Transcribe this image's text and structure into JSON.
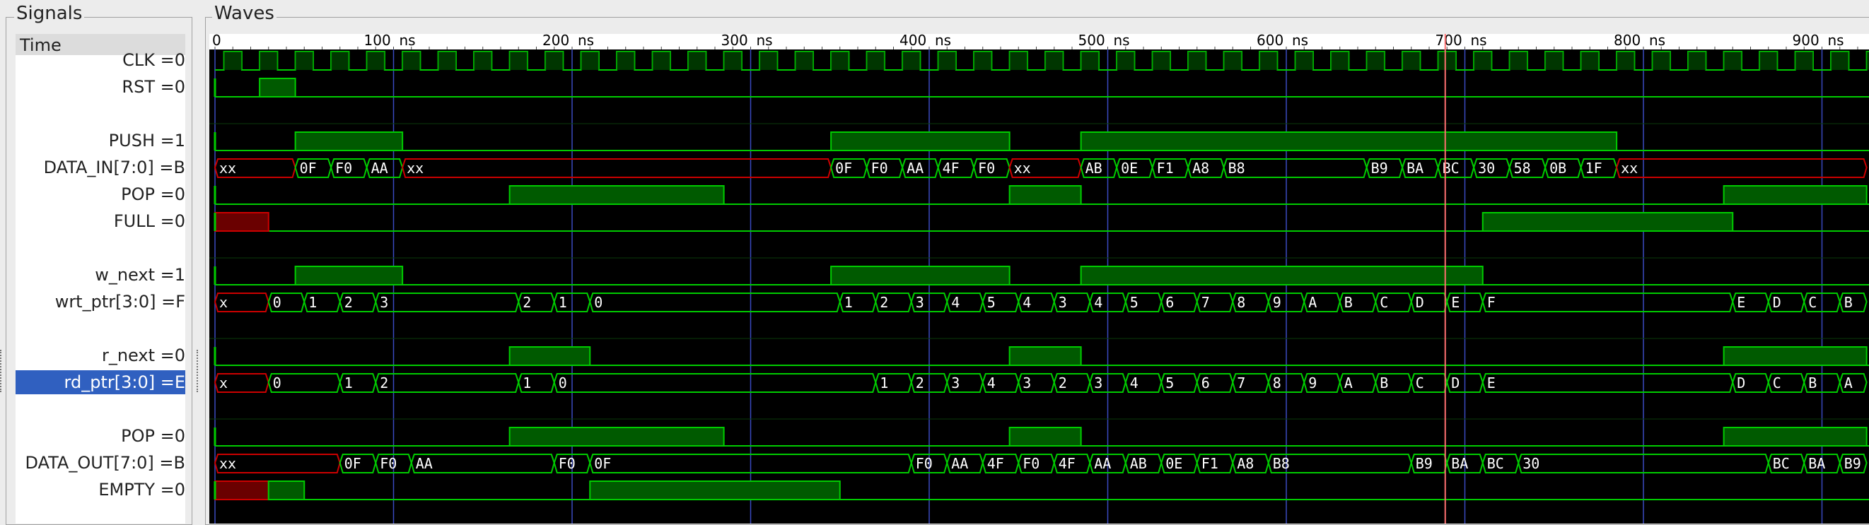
{
  "panels": {
    "signals_title": "Signals",
    "waves_title": "Waves"
  },
  "time_header": "Time",
  "time_axis": {
    "units": "ns",
    "labels": [
      "0",
      "100",
      "200",
      "300",
      "400",
      "500",
      "600",
      "700",
      "800",
      "900"
    ],
    "cursor_ns": 689
  },
  "colors": {
    "wave_bg": "#000000",
    "wave_green": "#00cc00",
    "wave_red": "#cc0000",
    "grid": "#3a4ac0",
    "cursor": "#ff7070",
    "selected": "#3060c0"
  },
  "signals": [
    {
      "label": "CLK =0",
      "kind": "clock"
    },
    {
      "label": "RST =0",
      "kind": "bit",
      "highs": [
        [
          25,
          45
        ]
      ]
    },
    {
      "label": "",
      "kind": "blank"
    },
    {
      "label": "PUSH =1",
      "kind": "bit",
      "highs": [
        [
          45,
          105
        ],
        [
          345,
          445
        ],
        [
          485,
          785
        ]
      ]
    },
    {
      "label": "DATA_IN[7:0] =B",
      "kind": "bus",
      "segments": [
        {
          "s": 0,
          "e": 45,
          "v": "xx",
          "red": true
        },
        {
          "s": 45,
          "e": 65,
          "v": "0F"
        },
        {
          "s": 65,
          "e": 85,
          "v": "F0"
        },
        {
          "s": 85,
          "e": 105,
          "v": "AA"
        },
        {
          "s": 105,
          "e": 345,
          "v": "xx",
          "red": true
        },
        {
          "s": 345,
          "e": 365,
          "v": "0F"
        },
        {
          "s": 365,
          "e": 385,
          "v": "F0"
        },
        {
          "s": 385,
          "e": 405,
          "v": "AA"
        },
        {
          "s": 405,
          "e": 425,
          "v": "4F"
        },
        {
          "s": 425,
          "e": 445,
          "v": "F0"
        },
        {
          "s": 445,
          "e": 485,
          "v": "xx",
          "red": true
        },
        {
          "s": 485,
          "e": 505,
          "v": "AB"
        },
        {
          "s": 505,
          "e": 525,
          "v": "0E"
        },
        {
          "s": 525,
          "e": 545,
          "v": "F1"
        },
        {
          "s": 545,
          "e": 565,
          "v": "A8"
        },
        {
          "s": 565,
          "e": 645,
          "v": "B8"
        },
        {
          "s": 645,
          "e": 665,
          "v": "B9"
        },
        {
          "s": 665,
          "e": 685,
          "v": "BA"
        },
        {
          "s": 685,
          "e": 705,
          "v": "BC"
        },
        {
          "s": 705,
          "e": 725,
          "v": "30"
        },
        {
          "s": 725,
          "e": 745,
          "v": "58"
        },
        {
          "s": 745,
          "e": 765,
          "v": "0B"
        },
        {
          "s": 765,
          "e": 785,
          "v": "1F"
        },
        {
          "s": 785,
          "e": 925,
          "v": "xx",
          "red": true
        }
      ]
    },
    {
      "label": "POP =0",
      "kind": "bit",
      "highs": [
        [
          165,
          285
        ],
        [
          445,
          485
        ],
        [
          845,
          925
        ]
      ]
    },
    {
      "label": "FULL =0",
      "kind": "bit",
      "red": [
        [
          0,
          30
        ]
      ],
      "highs": [
        [
          710,
          850
        ]
      ]
    },
    {
      "label": "",
      "kind": "blank"
    },
    {
      "label": "w_next =1",
      "kind": "bit",
      "highs": [
        [
          45,
          105
        ],
        [
          345,
          445
        ],
        [
          485,
          710
        ]
      ]
    },
    {
      "label": "wrt_ptr[3:0] =F",
      "kind": "bus",
      "segments": [
        {
          "s": 0,
          "e": 30,
          "v": "x",
          "red": true
        },
        {
          "s": 30,
          "e": 50,
          "v": "0"
        },
        {
          "s": 50,
          "e": 70,
          "v": "1"
        },
        {
          "s": 70,
          "e": 90,
          "v": "2"
        },
        {
          "s": 90,
          "e": 170,
          "v": "3"
        },
        {
          "s": 170,
          "e": 190,
          "v": "2"
        },
        {
          "s": 190,
          "e": 210,
          "v": "1"
        },
        {
          "s": 210,
          "e": 350,
          "v": "0"
        },
        {
          "s": 350,
          "e": 370,
          "v": "1"
        },
        {
          "s": 370,
          "e": 390,
          "v": "2"
        },
        {
          "s": 390,
          "e": 410,
          "v": "3"
        },
        {
          "s": 410,
          "e": 430,
          "v": "4"
        },
        {
          "s": 430,
          "e": 450,
          "v": "5"
        },
        {
          "s": 450,
          "e": 470,
          "v": "4"
        },
        {
          "s": 470,
          "e": 490,
          "v": "3"
        },
        {
          "s": 490,
          "e": 510,
          "v": "4"
        },
        {
          "s": 510,
          "e": 530,
          "v": "5"
        },
        {
          "s": 530,
          "e": 550,
          "v": "6"
        },
        {
          "s": 550,
          "e": 570,
          "v": "7"
        },
        {
          "s": 570,
          "e": 590,
          "v": "8"
        },
        {
          "s": 590,
          "e": 610,
          "v": "9"
        },
        {
          "s": 610,
          "e": 630,
          "v": "A"
        },
        {
          "s": 630,
          "e": 650,
          "v": "B"
        },
        {
          "s": 650,
          "e": 670,
          "v": "C"
        },
        {
          "s": 670,
          "e": 690,
          "v": "D"
        },
        {
          "s": 690,
          "e": 710,
          "v": "E"
        },
        {
          "s": 710,
          "e": 850,
          "v": "F"
        },
        {
          "s": 850,
          "e": 870,
          "v": "E"
        },
        {
          "s": 870,
          "e": 890,
          "v": "D"
        },
        {
          "s": 890,
          "e": 910,
          "v": "C"
        },
        {
          "s": 910,
          "e": 925,
          "v": "B"
        }
      ]
    },
    {
      "label": "",
      "kind": "blank"
    },
    {
      "label": "r_next =0",
      "kind": "bit",
      "highs": [
        [
          165,
          210
        ],
        [
          445,
          485
        ],
        [
          845,
          925
        ]
      ]
    },
    {
      "label": "rd_ptr[3:0] =E",
      "kind": "bus",
      "selected": true,
      "segments": [
        {
          "s": 0,
          "e": 30,
          "v": "x",
          "red": true
        },
        {
          "s": 30,
          "e": 70,
          "v": "0"
        },
        {
          "s": 70,
          "e": 90,
          "v": "1"
        },
        {
          "s": 90,
          "e": 170,
          "v": "2"
        },
        {
          "s": 170,
          "e": 190,
          "v": "1"
        },
        {
          "s": 190,
          "e": 370,
          "v": "0"
        },
        {
          "s": 370,
          "e": 390,
          "v": "1"
        },
        {
          "s": 390,
          "e": 410,
          "v": "2"
        },
        {
          "s": 410,
          "e": 430,
          "v": "3"
        },
        {
          "s": 430,
          "e": 450,
          "v": "4"
        },
        {
          "s": 450,
          "e": 470,
          "v": "3"
        },
        {
          "s": 470,
          "e": 490,
          "v": "2"
        },
        {
          "s": 490,
          "e": 510,
          "v": "3"
        },
        {
          "s": 510,
          "e": 530,
          "v": "4"
        },
        {
          "s": 530,
          "e": 550,
          "v": "5"
        },
        {
          "s": 550,
          "e": 570,
          "v": "6"
        },
        {
          "s": 570,
          "e": 590,
          "v": "7"
        },
        {
          "s": 590,
          "e": 610,
          "v": "8"
        },
        {
          "s": 610,
          "e": 630,
          "v": "9"
        },
        {
          "s": 630,
          "e": 650,
          "v": "A"
        },
        {
          "s": 650,
          "e": 670,
          "v": "B"
        },
        {
          "s": 670,
          "e": 690,
          "v": "C"
        },
        {
          "s": 690,
          "e": 710,
          "v": "D"
        },
        {
          "s": 710,
          "e": 850,
          "v": "E"
        },
        {
          "s": 850,
          "e": 870,
          "v": "D"
        },
        {
          "s": 870,
          "e": 890,
          "v": "C"
        },
        {
          "s": 890,
          "e": 910,
          "v": "B"
        },
        {
          "s": 910,
          "e": 925,
          "v": "A"
        }
      ]
    },
    {
      "label": "",
      "kind": "blank"
    },
    {
      "label": "POP =0",
      "kind": "bit",
      "highs": [
        [
          165,
          285
        ],
        [
          445,
          485
        ],
        [
          845,
          925
        ]
      ]
    },
    {
      "label": "DATA_OUT[7:0] =B",
      "kind": "bus",
      "segments": [
        {
          "s": 0,
          "e": 70,
          "v": "xx",
          "red": true
        },
        {
          "s": 70,
          "e": 90,
          "v": "0F"
        },
        {
          "s": 90,
          "e": 110,
          "v": "F0"
        },
        {
          "s": 110,
          "e": 190,
          "v": "AA"
        },
        {
          "s": 190,
          "e": 210,
          "v": "F0"
        },
        {
          "s": 210,
          "e": 390,
          "v": "0F"
        },
        {
          "s": 390,
          "e": 410,
          "v": "F0"
        },
        {
          "s": 410,
          "e": 430,
          "v": "AA"
        },
        {
          "s": 430,
          "e": 450,
          "v": "4F"
        },
        {
          "s": 450,
          "e": 470,
          "v": "F0"
        },
        {
          "s": 470,
          "e": 490,
          "v": "4F"
        },
        {
          "s": 490,
          "e": 510,
          "v": "AA"
        },
        {
          "s": 510,
          "e": 530,
          "v": "AB"
        },
        {
          "s": 530,
          "e": 550,
          "v": "0E"
        },
        {
          "s": 550,
          "e": 570,
          "v": "F1"
        },
        {
          "s": 570,
          "e": 590,
          "v": "A8"
        },
        {
          "s": 590,
          "e": 670,
          "v": "B8"
        },
        {
          "s": 670,
          "e": 690,
          "v": "B9"
        },
        {
          "s": 690,
          "e": 710,
          "v": "BA"
        },
        {
          "s": 710,
          "e": 730,
          "v": "BC"
        },
        {
          "s": 730,
          "e": 870,
          "v": "30"
        },
        {
          "s": 870,
          "e": 890,
          "v": "BC"
        },
        {
          "s": 890,
          "e": 910,
          "v": "BA"
        },
        {
          "s": 910,
          "e": 925,
          "v": "B9"
        }
      ]
    },
    {
      "label": "EMPTY =0",
      "kind": "bit",
      "red": [
        [
          0,
          30
        ]
      ],
      "highs": [
        [
          30,
          50
        ],
        [
          210,
          350
        ]
      ]
    }
  ]
}
